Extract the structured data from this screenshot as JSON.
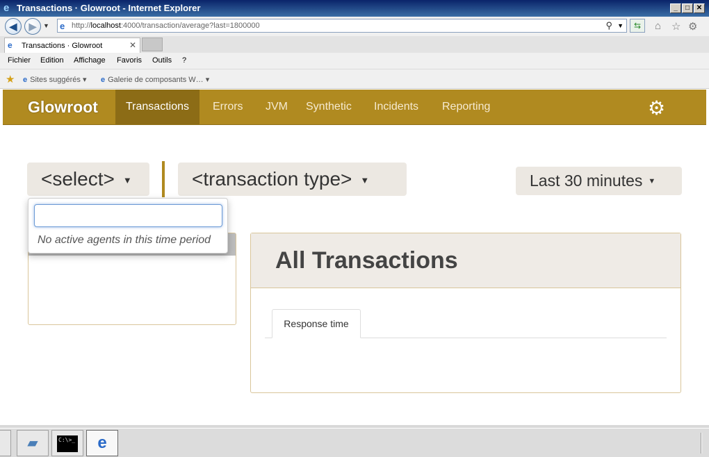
{
  "window": {
    "title": "Transactions · Glowroot - Internet Explorer",
    "min": "_",
    "max": "□",
    "close": "✕"
  },
  "address": {
    "url_prefix": "http://",
    "url_host": "localhost",
    "url_rest": ":4000/transaction/average?last=1800000"
  },
  "tab": {
    "label": "Transactions · Glowroot",
    "close": "✕"
  },
  "menu": [
    "Fichier",
    "Edition",
    "Affichage",
    "Favoris",
    "Outils",
    "?"
  ],
  "favorites": [
    {
      "label": "Sites suggérés ▾"
    },
    {
      "label": "Galerie de composants W… ▾"
    }
  ],
  "glowroot": {
    "brand": "Glowroot",
    "nav": [
      "Transactions",
      "Errors",
      "JVM",
      "Synthetic",
      "Incidents",
      "Reporting"
    ],
    "active_nav": "Transactions",
    "accent": "#b08a20"
  },
  "selectors": {
    "agent": "<select>",
    "transaction_type": "<transaction type>",
    "time_range": "Last 30 minutes"
  },
  "popup": {
    "input_value": "",
    "message": "No active agents in this time period"
  },
  "main": {
    "heading": "All Transactions",
    "tab": "Response time"
  },
  "taskbar": {
    "cmd_text": "C:\\>_"
  }
}
